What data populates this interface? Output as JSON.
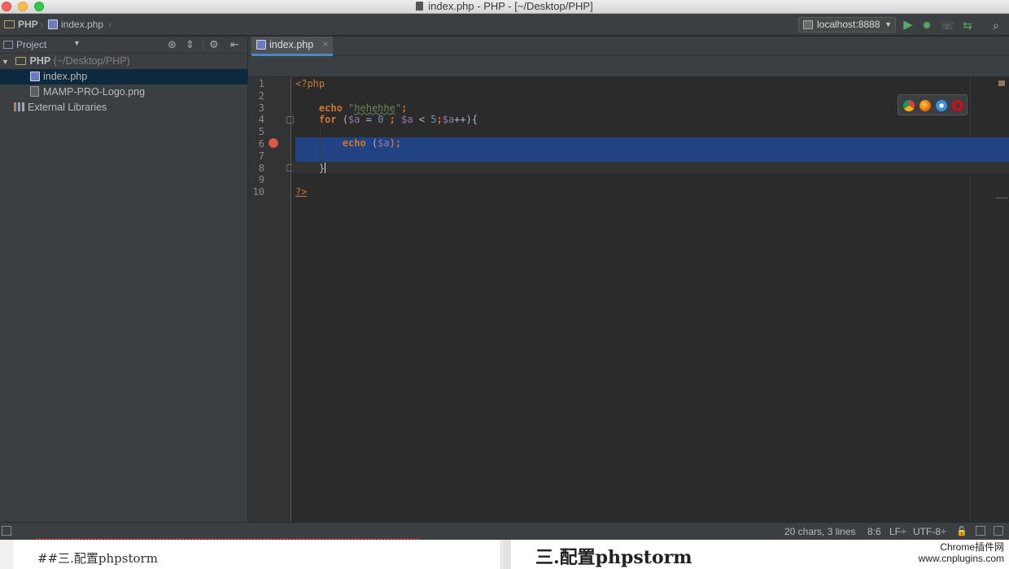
{
  "window": {
    "title": "index.php - PHP - [~/Desktop/PHP]"
  },
  "navbar": {
    "crumbs": [
      "PHP",
      "index.php"
    ],
    "run_config": "localhost:8888"
  },
  "project_panel": {
    "title": "Project",
    "root_name": "PHP",
    "root_path": "(~/Desktop/PHP)",
    "files": [
      "index.php",
      "MAMP-PRO-Logo.png"
    ],
    "external_libraries": "External Libraries"
  },
  "editor": {
    "active_tab": "index.php",
    "line_numbers": [
      "1",
      "2",
      "3",
      "4",
      "5",
      "6",
      "7",
      "8",
      "9",
      "10"
    ],
    "code": {
      "l1_open": "<?php",
      "l3_echo": "echo",
      "l3_string": "hehehhe",
      "l4_for": "for",
      "l4_var_a": "$a",
      "l4_eq": " = ",
      "l4_zero": "0",
      "l4_sep": " ; ",
      "l4_var_a2": "$a",
      "l4_lt": " < ",
      "l4_five": "5",
      "l4_semi": ";",
      "l4_var_a3": "$a",
      "l4_tail": "++){",
      "l6_echo": "echo",
      "l6_open": " (",
      "l6_var": "$a",
      "l6_close": ");",
      "l8_brace": "}",
      "l10_close": "?>"
    }
  },
  "statusbar": {
    "chars": "20 chars, 3 lines",
    "position": "8:6",
    "line_sep": "LF÷",
    "encoding": "UTF-8÷"
  },
  "article": {
    "left_heading": "##三.配置phpstorm",
    "right_heading": "三.配置phpstorm",
    "watermark_line1": "Chrome插件网",
    "watermark_line2": "www.cnplugins.com"
  }
}
